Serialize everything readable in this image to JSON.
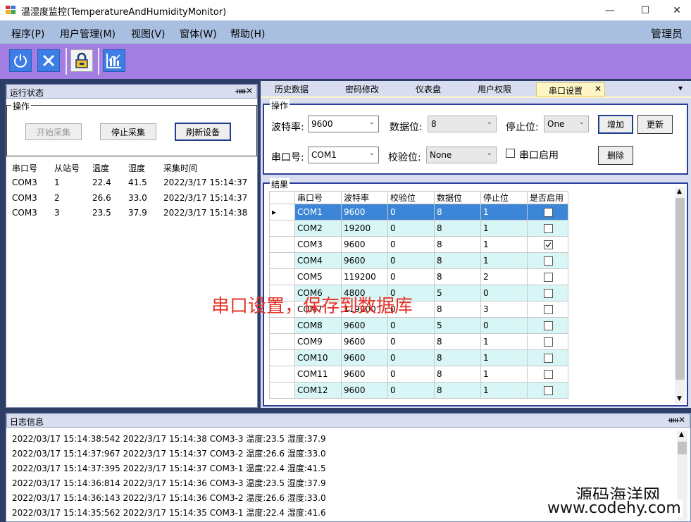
{
  "window": {
    "title": "温湿度监控(TemperatureAndHumidityMonitor)",
    "minimize": "—",
    "maximize": "☐",
    "close": "✕"
  },
  "menu": {
    "items": [
      "程序(P)",
      "用户管理(M)",
      "视图(V)",
      "窗体(W)",
      "帮助(H)"
    ],
    "user_role": "管理员"
  },
  "toolbar": {
    "icons": [
      "power-icon",
      "close-icon",
      "lock-icon",
      "chart-icon"
    ]
  },
  "left_panel": {
    "title": "运行状态",
    "pin": "ᚔ",
    "close": "✕",
    "ops_label": "操作",
    "buttons": [
      "开始采集",
      "停止采集",
      "刷新设备"
    ],
    "columns": [
      "串口号",
      "从站号",
      "温度",
      "湿度",
      "采集时间"
    ],
    "rows": [
      [
        "COM3",
        "1",
        "22.4",
        "41.5",
        "2022/3/17 15:14:37"
      ],
      [
        "COM3",
        "2",
        "26.6",
        "33.0",
        "2022/3/17 15:14:37"
      ],
      [
        "COM3",
        "3",
        "23.5",
        "37.9",
        "2022/3/17 15:14:38"
      ]
    ]
  },
  "tabs": {
    "items": [
      "历史数据",
      "密码修改",
      "仪表盘",
      "用户权限",
      "串口设置"
    ],
    "active": "串口设置",
    "close": "✕",
    "overflow": "▾"
  },
  "serial_ops": {
    "label": "操作",
    "baud_label": "波特率:",
    "baud_value": "9600",
    "data_bits_label": "数据位:",
    "data_bits_value": "8",
    "stop_bits_label": "停止位:",
    "stop_bits_value": "One",
    "port_label": "串口号:",
    "port_value": "COM1",
    "parity_label": "校验位:",
    "parity_value": "None",
    "enable_label": "串口启用",
    "add_button": "增加",
    "update_button": "更新",
    "delete_button": "删除"
  },
  "result": {
    "label": "结果",
    "columns": [
      "串口号",
      "波特率",
      "校验位",
      "数据位",
      "停止位",
      "是否启用"
    ],
    "rows": [
      {
        "port": "COM1",
        "baud": "9600",
        "parity": "0",
        "data": "8",
        "stop": "1",
        "enabled": false
      },
      {
        "port": "COM2",
        "baud": "19200",
        "parity": "0",
        "data": "8",
        "stop": "1",
        "enabled": false
      },
      {
        "port": "COM3",
        "baud": "9600",
        "parity": "0",
        "data": "8",
        "stop": "1",
        "enabled": true
      },
      {
        "port": "COM4",
        "baud": "9600",
        "parity": "0",
        "data": "8",
        "stop": "1",
        "enabled": false
      },
      {
        "port": "COM5",
        "baud": "119200",
        "parity": "0",
        "data": "8",
        "stop": "2",
        "enabled": false
      },
      {
        "port": "COM6",
        "baud": "4800",
        "parity": "0",
        "data": "5",
        "stop": "0",
        "enabled": false
      },
      {
        "port": "COM7",
        "baud": "119200",
        "parity": "0",
        "data": "8",
        "stop": "3",
        "enabled": false
      },
      {
        "port": "COM8",
        "baud": "9600",
        "parity": "0",
        "data": "5",
        "stop": "0",
        "enabled": false
      },
      {
        "port": "COM9",
        "baud": "9600",
        "parity": "0",
        "data": "8",
        "stop": "1",
        "enabled": false
      },
      {
        "port": "COM10",
        "baud": "9600",
        "parity": "0",
        "data": "8",
        "stop": "1",
        "enabled": false
      },
      {
        "port": "COM11",
        "baud": "9600",
        "parity": "0",
        "data": "8",
        "stop": "1",
        "enabled": false
      },
      {
        "port": "COM12",
        "baud": "9600",
        "parity": "0",
        "data": "8",
        "stop": "1",
        "enabled": false
      }
    ],
    "overlay_text": "串口设置，保存到数据库"
  },
  "log": {
    "title": "日志信息",
    "pin": "ᚔ",
    "close": "✕",
    "lines": [
      "2022/03/17 15:14:38:542  2022/3/17 15:14:38 COM3-3 温度:23.5 湿度:37.9",
      "2022/03/17 15:14:37:967  2022/3/17 15:14:37 COM3-2 温度:26.6 湿度:33.0",
      "2022/03/17 15:14:37:395  2022/3/17 15:14:37 COM3-1 温度:22.4 湿度:41.5",
      "2022/03/17 15:14:36:814  2022/3/17 15:14:36 COM3-3 温度:23.5 湿度:37.9",
      "2022/03/17 15:14:36:143  2022/3/17 15:14:36 COM3-2 温度:26.6 湿度:33.0",
      "2022/03/17 15:14:35:562  2022/3/17 15:14:35 COM3-1 温度:22.4 湿度:41.6"
    ]
  },
  "watermark": {
    "line1": "源码海洋网",
    "line2": "www.codehy.com"
  }
}
